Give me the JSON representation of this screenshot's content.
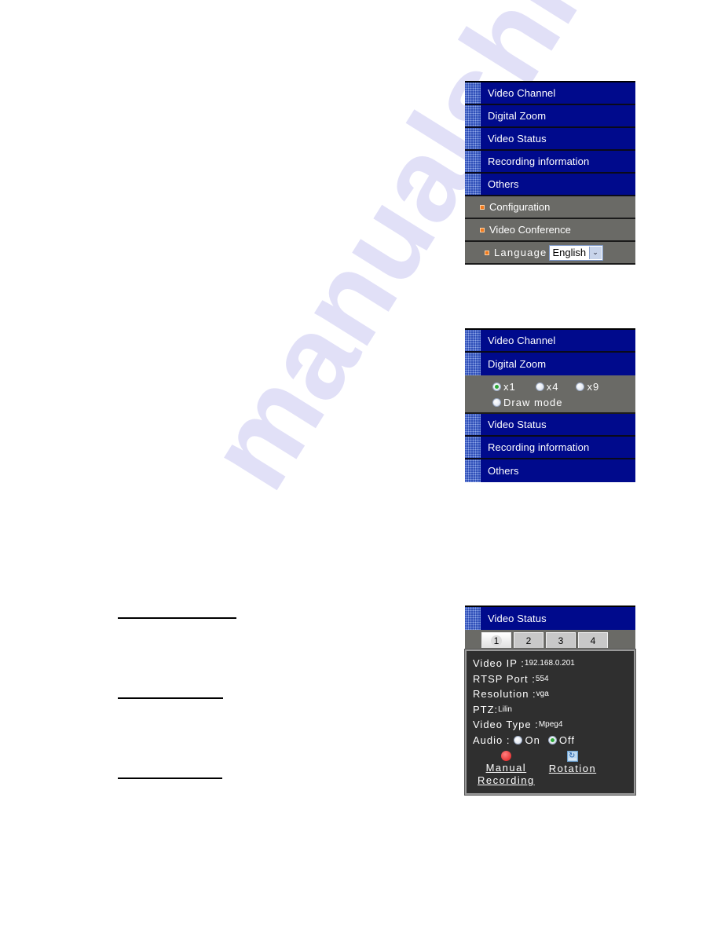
{
  "watermark": "manualshive.com",
  "panel_others": {
    "menu": [
      "Video Channel",
      "Digital Zoom",
      "Video Status",
      "Recording information",
      "Others"
    ],
    "sub_items": [
      "Configuration",
      "Video Conference"
    ],
    "language_label": "Language",
    "language_value": "English"
  },
  "panel_zoom": {
    "menu_top": [
      "Video Channel",
      "Digital Zoom"
    ],
    "zoom_options": [
      {
        "label": "x1",
        "selected": true
      },
      {
        "label": "x4",
        "selected": false
      },
      {
        "label": "x9",
        "selected": false
      }
    ],
    "draw_mode": {
      "label": "Draw mode",
      "selected": false
    },
    "menu_bottom": [
      "Video Status",
      "Recording information",
      "Others"
    ]
  },
  "panel_status": {
    "header": "Video Status",
    "tabs": [
      "1",
      "2",
      "3",
      "4"
    ],
    "active_tab": "1",
    "fields": {
      "video_ip_label": "Video IP :",
      "video_ip": "192.168.0.201",
      "rtsp_label": "RTSP Port :",
      "rtsp": "554",
      "resolution_label": "Resolution :",
      "resolution": "vga",
      "ptz_label": "PTZ:",
      "ptz": "Lilin",
      "video_type_label": "Video Type :",
      "video_type": "Mpeg4"
    },
    "audio_label": "Audio :",
    "audio_options": [
      {
        "label": "On",
        "selected": false
      },
      {
        "label": "Off",
        "selected": true
      }
    ],
    "manual_recording_line1": "Manual",
    "manual_recording_line2": "Recording",
    "rotation": "Rotation"
  }
}
